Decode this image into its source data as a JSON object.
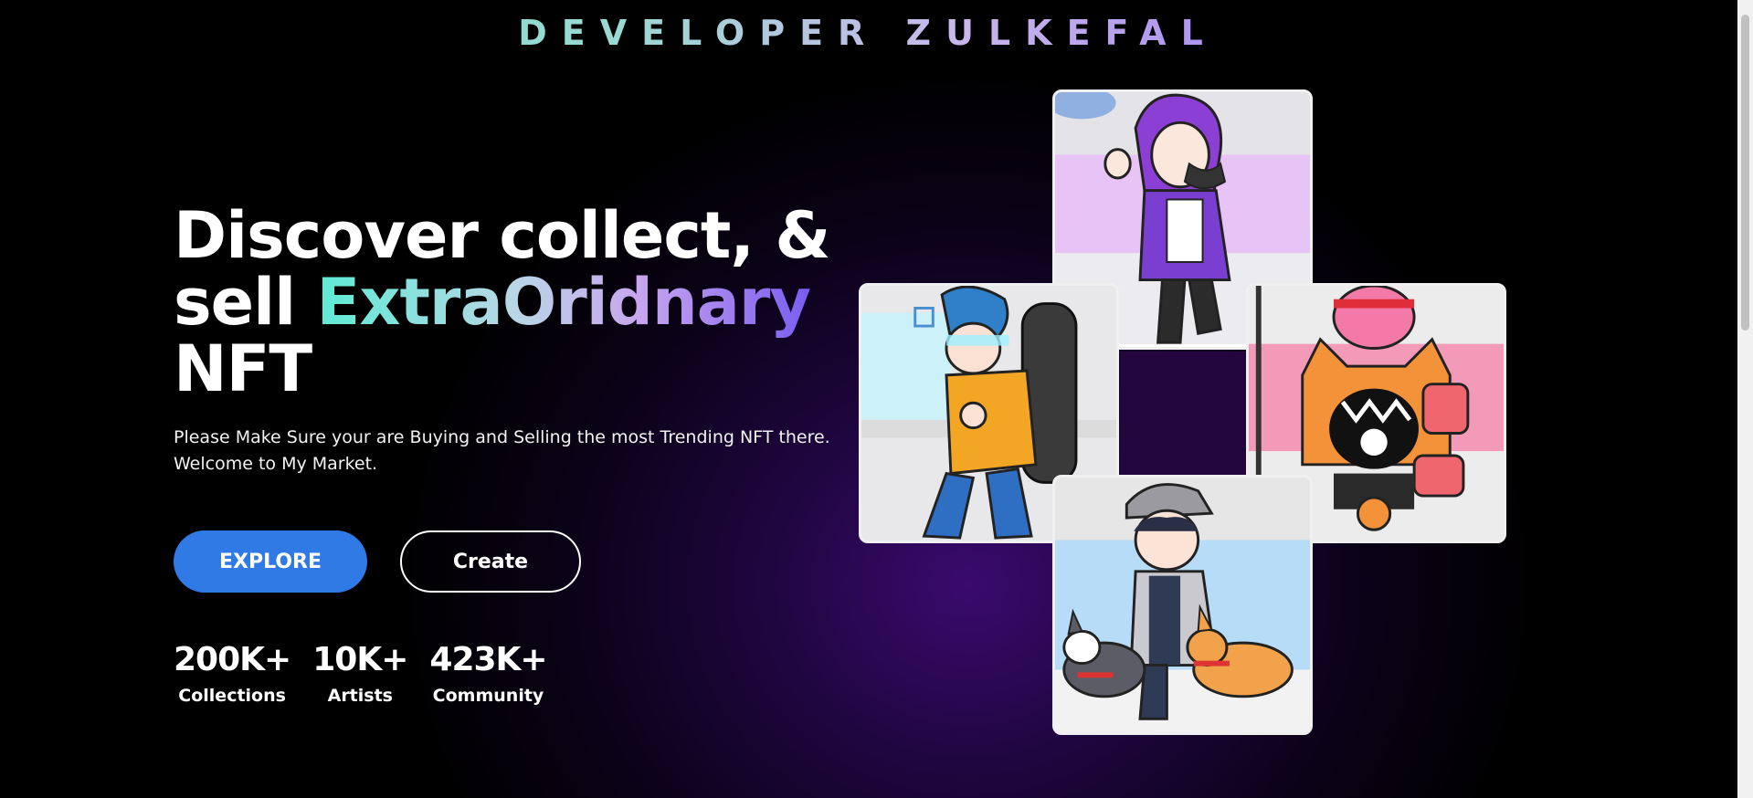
{
  "brand": {
    "title": "DEVELOPER ZULKEFAL"
  },
  "hero": {
    "line1": "Discover collect, &",
    "line2_plain": "sell ",
    "line2_gradient": "ExtraOridnary",
    "line3": "NFT",
    "description": "Please Make Sure your are Buying and Selling the most Trending NFT there. Welcome to My Market."
  },
  "buttons": {
    "explore": "EXPLORE",
    "create": "Create"
  },
  "stats": [
    {
      "value": "200K+",
      "label": "Collections"
    },
    {
      "value": "10K+",
      "label": "Artists"
    },
    {
      "value": "423K+",
      "label": "Community"
    }
  ],
  "colors": {
    "accent_blue": "#2f7ae5",
    "gradient_start": "#5eead4",
    "gradient_end": "#7c5cf0",
    "background_glow": "#3a0a6e"
  },
  "gallery": [
    {
      "name": "purple-hair-girl-nft",
      "icon": "character-illustration"
    },
    {
      "name": "blue-hair-skater-nft",
      "icon": "character-illustration"
    },
    {
      "name": "samurai-cat-nft",
      "icon": "character-illustration"
    },
    {
      "name": "boy-walking-dogs-nft",
      "icon": "character-illustration"
    }
  ]
}
